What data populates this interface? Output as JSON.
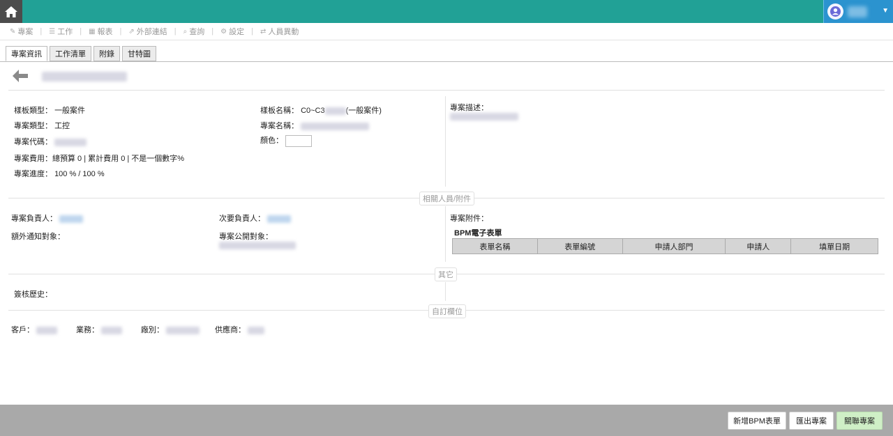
{
  "header": {
    "home_icon": "home-icon",
    "user_icon": "user-avatar-icon"
  },
  "menu": [
    {
      "icon": "edit-icon",
      "label": "專案"
    },
    {
      "icon": "list-icon",
      "label": "工作"
    },
    {
      "icon": "chart-icon",
      "label": "報表"
    },
    {
      "icon": "external-link-icon",
      "label": "外部連結"
    },
    {
      "icon": "search-icon",
      "label": "查詢"
    },
    {
      "icon": "gear-icon",
      "label": "設定"
    },
    {
      "icon": "exchange-icon",
      "label": "人員異動"
    }
  ],
  "tabs": [
    "專案資訊",
    "工作清單",
    "附錄",
    "甘特圖"
  ],
  "info": {
    "template_type_label": "樣板類型：",
    "template_type_value": "一般案件",
    "project_type_label": "專案類型：",
    "project_type_value": "工控",
    "project_code_label": "專案代碼：",
    "project_cost_label": "專案費用：",
    "project_cost_value": "總預算 0 | 累計費用 0 | 不是一個數字%",
    "project_progress_label": "專案進度：",
    "project_progress_value": "100 % / 100 %",
    "template_name_label": "樣板名稱：",
    "template_name_prefix": "C0~C3",
    "template_name_suffix": "(一般案件)",
    "project_name_label": "專案名稱：",
    "color_label": "顏色：",
    "description_label": "專案描述："
  },
  "sections": {
    "related": "相關人員/附件",
    "other": "其它",
    "custom": "自訂欄位"
  },
  "people": {
    "owner_label": "專案負責人：",
    "secondary_owner_label": "次要負責人：",
    "notify_label": "額外通知對象：",
    "public_label": "專案公開對象：",
    "attachment_label": "專案附件：",
    "bpm_title": "BPM電子表單"
  },
  "bpm_columns": [
    "表單名稱",
    "表單編號",
    "申請人部門",
    "申請人",
    "填單日期"
  ],
  "other": {
    "sign_history_label": "簽核歷史："
  },
  "custom": {
    "customer_label": "客戶：",
    "business_label": "業務：",
    "factory_label": "廠別：",
    "supplier_label": "供應商："
  },
  "footer": {
    "add_bpm": "新增BPM表單",
    "export": "匯出專案",
    "link": "關聯專案"
  }
}
